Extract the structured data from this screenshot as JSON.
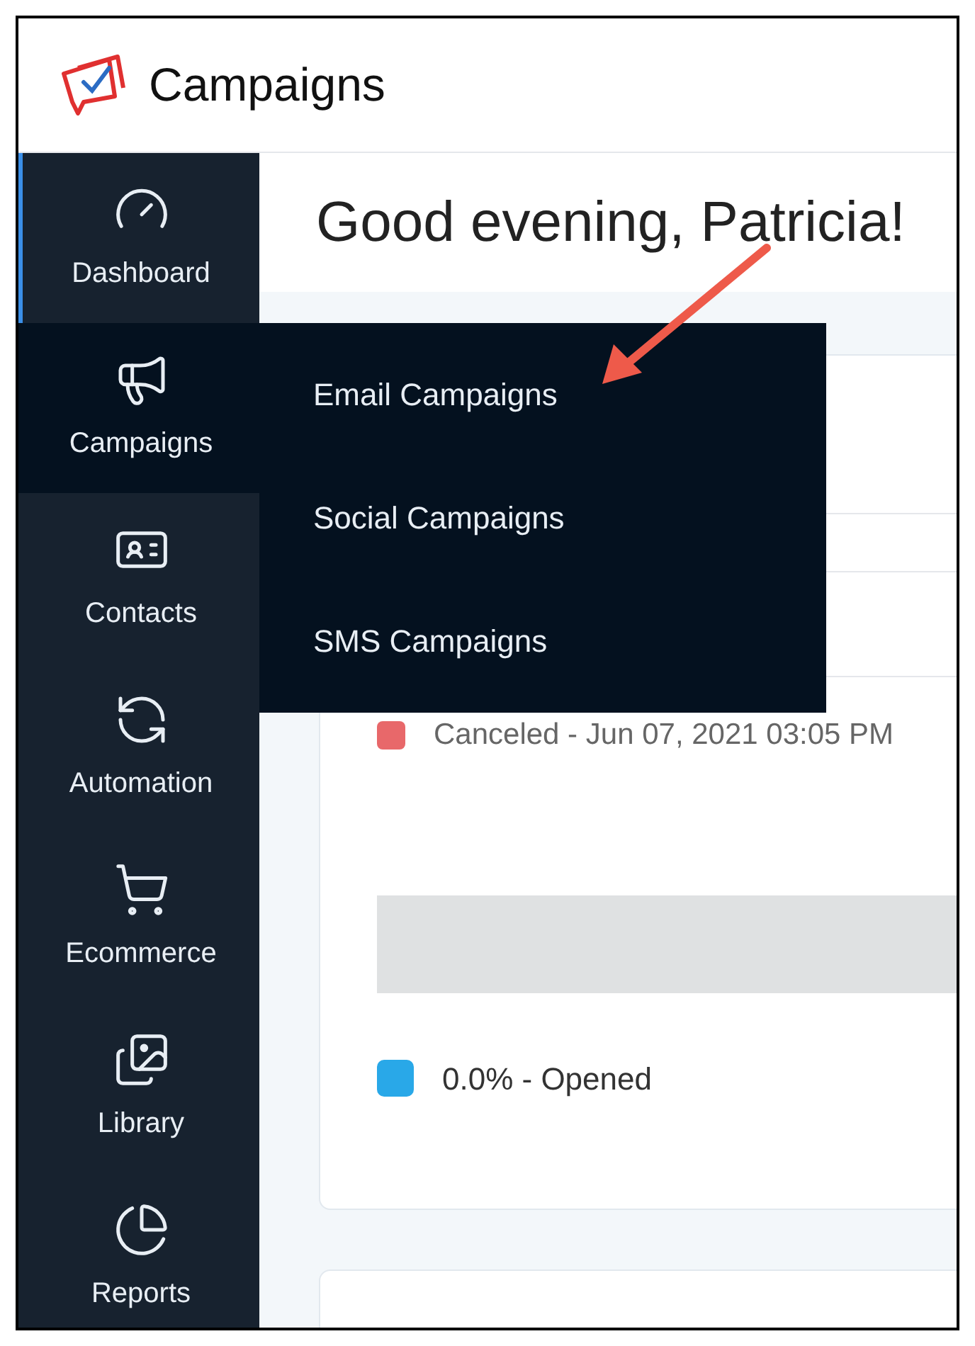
{
  "app": {
    "title": "Campaigns"
  },
  "sidebar": {
    "items": [
      {
        "label": "Dashboard",
        "selected": true,
        "expanded": false
      },
      {
        "label": "Campaigns",
        "selected": false,
        "expanded": true
      },
      {
        "label": "Contacts",
        "selected": false,
        "expanded": false
      },
      {
        "label": "Automation",
        "selected": false,
        "expanded": false
      },
      {
        "label": "Ecommerce",
        "selected": false,
        "expanded": false
      },
      {
        "label": "Library",
        "selected": false,
        "expanded": false
      },
      {
        "label": "Reports",
        "selected": false,
        "expanded": false
      }
    ]
  },
  "flyout_menu": {
    "items": [
      "Email Campaigns",
      "Social Campaigns",
      "SMS Campaigns"
    ]
  },
  "greeting": "Good evening, Patricia!",
  "card": {
    "status": {
      "text": "Canceled - Jun 07, 2021 03:05 PM",
      "color": "#e8686a"
    },
    "legend": {
      "text": "0.0% - Opened",
      "color": "#29a8e8"
    }
  }
}
